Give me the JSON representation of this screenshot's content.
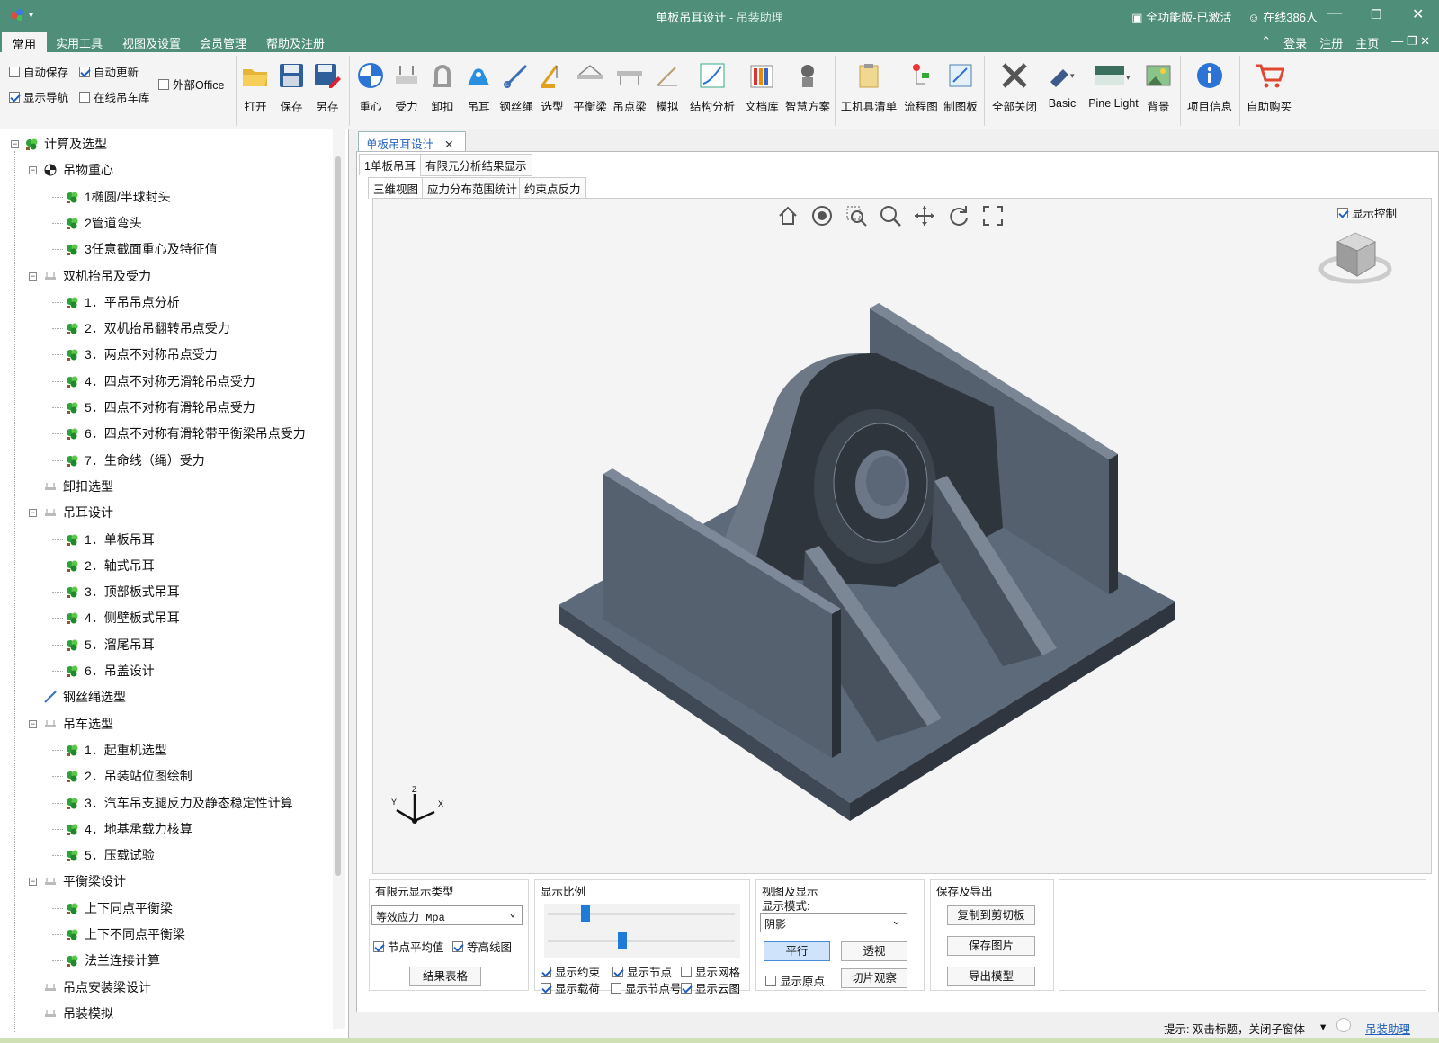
{
  "titlebar": {
    "title": "单板吊耳设计",
    "app": " - 吊装助理",
    "edition": "全功能版-已激活",
    "online": "在线386人"
  },
  "menubar": {
    "tabs": [
      "常用",
      "实用工具",
      "视图及设置",
      "会员管理",
      "帮助及注册"
    ],
    "right": [
      "登录",
      "注册",
      "主页"
    ]
  },
  "ribbon": {
    "options": {
      "autosave": "自动保存",
      "autoupdate": "自动更新",
      "external_office": "外部Office",
      "show_nav": "显示导航",
      "online_crane": "在线吊车库"
    },
    "buttons": [
      "打开",
      "保存",
      "另存",
      "重心",
      "受力",
      "卸扣",
      "吊耳",
      "钢丝绳",
      "选型",
      "平衡梁",
      "吊点梁",
      "模拟",
      "结构分析",
      "文档库",
      "智慧方案",
      "工机具清单",
      "流程图",
      "制图板",
      "全部关闭",
      "Basic",
      "Pine Light",
      "背景",
      "项目信息",
      "自助购买"
    ]
  },
  "tree": {
    "root": "计算及选型",
    "items": [
      "吊物重心",
      "1椭圆/半球封头",
      "2管道弯头",
      "3任意截面重心及特征值",
      "双机抬吊及受力",
      "1．平吊吊点分析",
      "2．双机抬吊翻转吊点受力",
      "3．两点不对称吊点受力",
      "4．四点不对称无滑轮吊点受力",
      "5．四点不对称有滑轮吊点受力",
      "6．四点不对称有滑轮带平衡梁吊点受力",
      "7．生命线（绳）受力",
      "卸扣选型",
      "吊耳设计",
      "1．单板吊耳",
      "2．轴式吊耳",
      "3．顶部板式吊耳",
      "4．侧壁板式吊耳",
      "5．溜尾吊耳",
      "6．吊盖设计",
      "钢丝绳选型",
      "吊车选型",
      "1．起重机选型",
      "2．吊装站位图绘制",
      "3．汽车吊支腿反力及静态稳定性计算",
      "4．地基承载力核算",
      "5．压载试验",
      "平衡梁设计",
      "上下同点平衡梁",
      "上下不同点平衡梁",
      "法兰连接计算",
      "吊点安装梁设计",
      "吊装模拟"
    ]
  },
  "doc": {
    "tab": "单板吊耳设计",
    "subtabs": [
      "1单板吊耳",
      "有限元分析结果显示"
    ],
    "viewtabs": [
      "三维视图",
      "应力分布范围统计",
      "约束点反力"
    ],
    "show_control": "显示控制",
    "axes": {
      "x": "X",
      "y": "Y",
      "z": "Z"
    }
  },
  "panel": {
    "fem": {
      "title": "有限元显示类型",
      "type_value": "等效应力 Mpa",
      "node_avg": "节点平均值",
      "contour": "等高线图",
      "table_btn": "结果表格"
    },
    "scale": {
      "title": "显示比例",
      "slider1": 0.2,
      "slider2": 0.4,
      "show_constraint": "显示约束",
      "show_node": "显示节点",
      "show_mesh": "显示网格",
      "show_load": "显示载荷",
      "show_node_no": "显示节点号",
      "show_cloud": "显示云图"
    },
    "view": {
      "title": "视图及显示",
      "mode_label": "显示模式:",
      "mode_value": "阴影",
      "parallel": "平行",
      "perspective": "透视",
      "show_origin": "显示原点",
      "slice": "切片观察"
    },
    "export": {
      "title": "保存及导出",
      "copy": "复制到剪切板",
      "save_img": "保存图片",
      "export_model": "导出模型"
    }
  },
  "status": {
    "hint": "提示: 双击标题，关闭子窗体",
    "link": "吊装助理"
  },
  "colors": {
    "title_bg": "#4f8f7a",
    "model_top": "#5b6878",
    "model_side": "#3d4652",
    "model_dark": "#2d333b",
    "accent": "#1f5fbf"
  }
}
